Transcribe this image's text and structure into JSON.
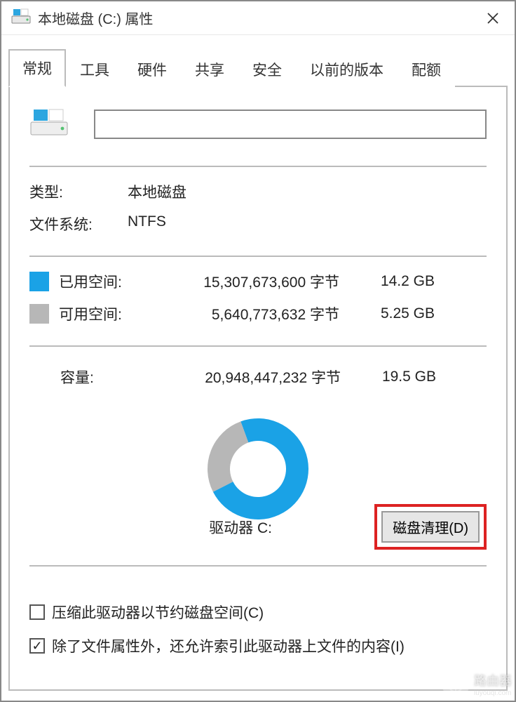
{
  "window": {
    "title": "本地磁盘 (C:) 属性"
  },
  "tabs": [
    {
      "label": "常规",
      "active": true
    },
    {
      "label": "工具",
      "active": false
    },
    {
      "label": "硬件",
      "active": false
    },
    {
      "label": "共享",
      "active": false
    },
    {
      "label": "安全",
      "active": false
    },
    {
      "label": "以前的版本",
      "active": false
    },
    {
      "label": "配额",
      "active": false
    }
  ],
  "general": {
    "drive_name": "",
    "type_label": "类型:",
    "type_value": "本地磁盘",
    "filesystem_label": "文件系统:",
    "filesystem_value": "NTFS",
    "used_label": "已用空间:",
    "used_bytes": "15,307,673,600 字节",
    "used_gb": "14.2 GB",
    "free_label": "可用空间:",
    "free_bytes": "5,640,773,632 字节",
    "free_gb": "5.25 GB",
    "capacity_label": "容量:",
    "capacity_bytes": "20,948,447,232 字节",
    "capacity_gb": "19.5 GB",
    "drive_caption": "驱动器 C:",
    "cleanup_button": "磁盘清理(D)",
    "compress_checkbox": "压缩此驱动器以节约磁盘空间(C)",
    "compress_checked": false,
    "index_checkbox": "除了文件属性外，还允许索引此驱动器上文件的内容(I)",
    "index_checked": true
  },
  "colors": {
    "used": "#1aa2e6",
    "free": "#b7b7b7",
    "highlight": "#d22222"
  },
  "chart_data": {
    "type": "pie",
    "title": "驱动器 C:",
    "categories": [
      "已用空间",
      "可用空间"
    ],
    "values": [
      15307673600,
      5640773632
    ],
    "series_colors": [
      "#1aa2e6",
      "#b7b7b7"
    ],
    "used_fraction": 0.731
  },
  "watermark": {
    "text": "路由器",
    "sub": "luyouqi.com"
  }
}
